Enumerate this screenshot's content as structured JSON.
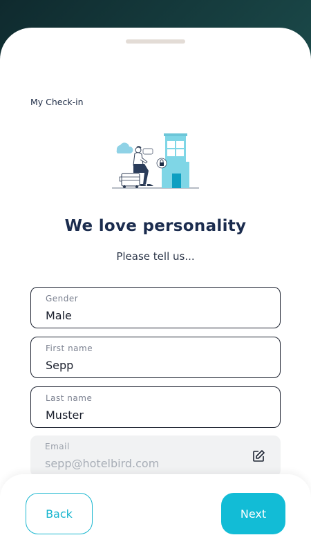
{
  "header": {
    "section_title": "My Check-in"
  },
  "hero": {
    "title": "We love personality",
    "subtitle": "Please tell us..."
  },
  "form": {
    "gender": {
      "label": "Gender",
      "value": "Male"
    },
    "first_name": {
      "label": "First name",
      "value": "Sepp"
    },
    "last_name": {
      "label": "Last name",
      "value": "Muster"
    },
    "email": {
      "label": "Email",
      "value": "sepp@hotelbird.com",
      "icon": "edit-icon"
    }
  },
  "footer": {
    "back_label": "Back",
    "next_label": "Next"
  },
  "colors": {
    "accent": "#12bcd6",
    "heading": "#1b2c4e",
    "illustration_building": "#7fd6e6"
  }
}
